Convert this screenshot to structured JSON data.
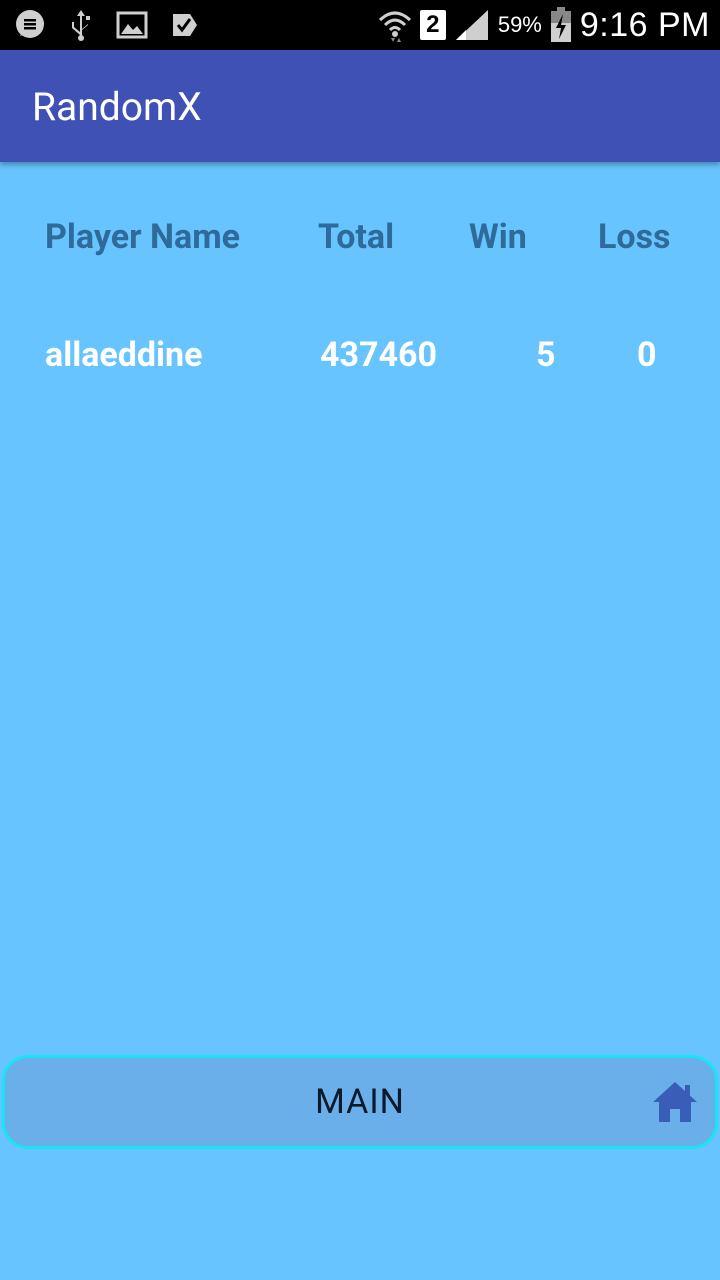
{
  "status_bar": {
    "left_icons": [
      "chat-icon",
      "usb-icon",
      "image-icon",
      "check-icon"
    ],
    "sim_badge": "2",
    "battery_percent": "59%",
    "time": "9:16 PM"
  },
  "app_bar": {
    "title": "RandomX"
  },
  "table": {
    "headers": {
      "name": "Player Name",
      "total": "Total",
      "win": "Win",
      "loss": "Loss"
    },
    "rows": [
      {
        "name": "allaeddine",
        "total": "437460",
        "win": "5",
        "loss": "0"
      }
    ]
  },
  "main_button": {
    "label": "MAIN",
    "icon": "home-icon"
  },
  "colors": {
    "background": "#67c4fe",
    "app_bar": "#3f51b5",
    "header_text": "#2e6a9a",
    "button_fill": "#6aaeea",
    "button_border": "#18e4f6",
    "home_icon": "#3a5db8"
  }
}
